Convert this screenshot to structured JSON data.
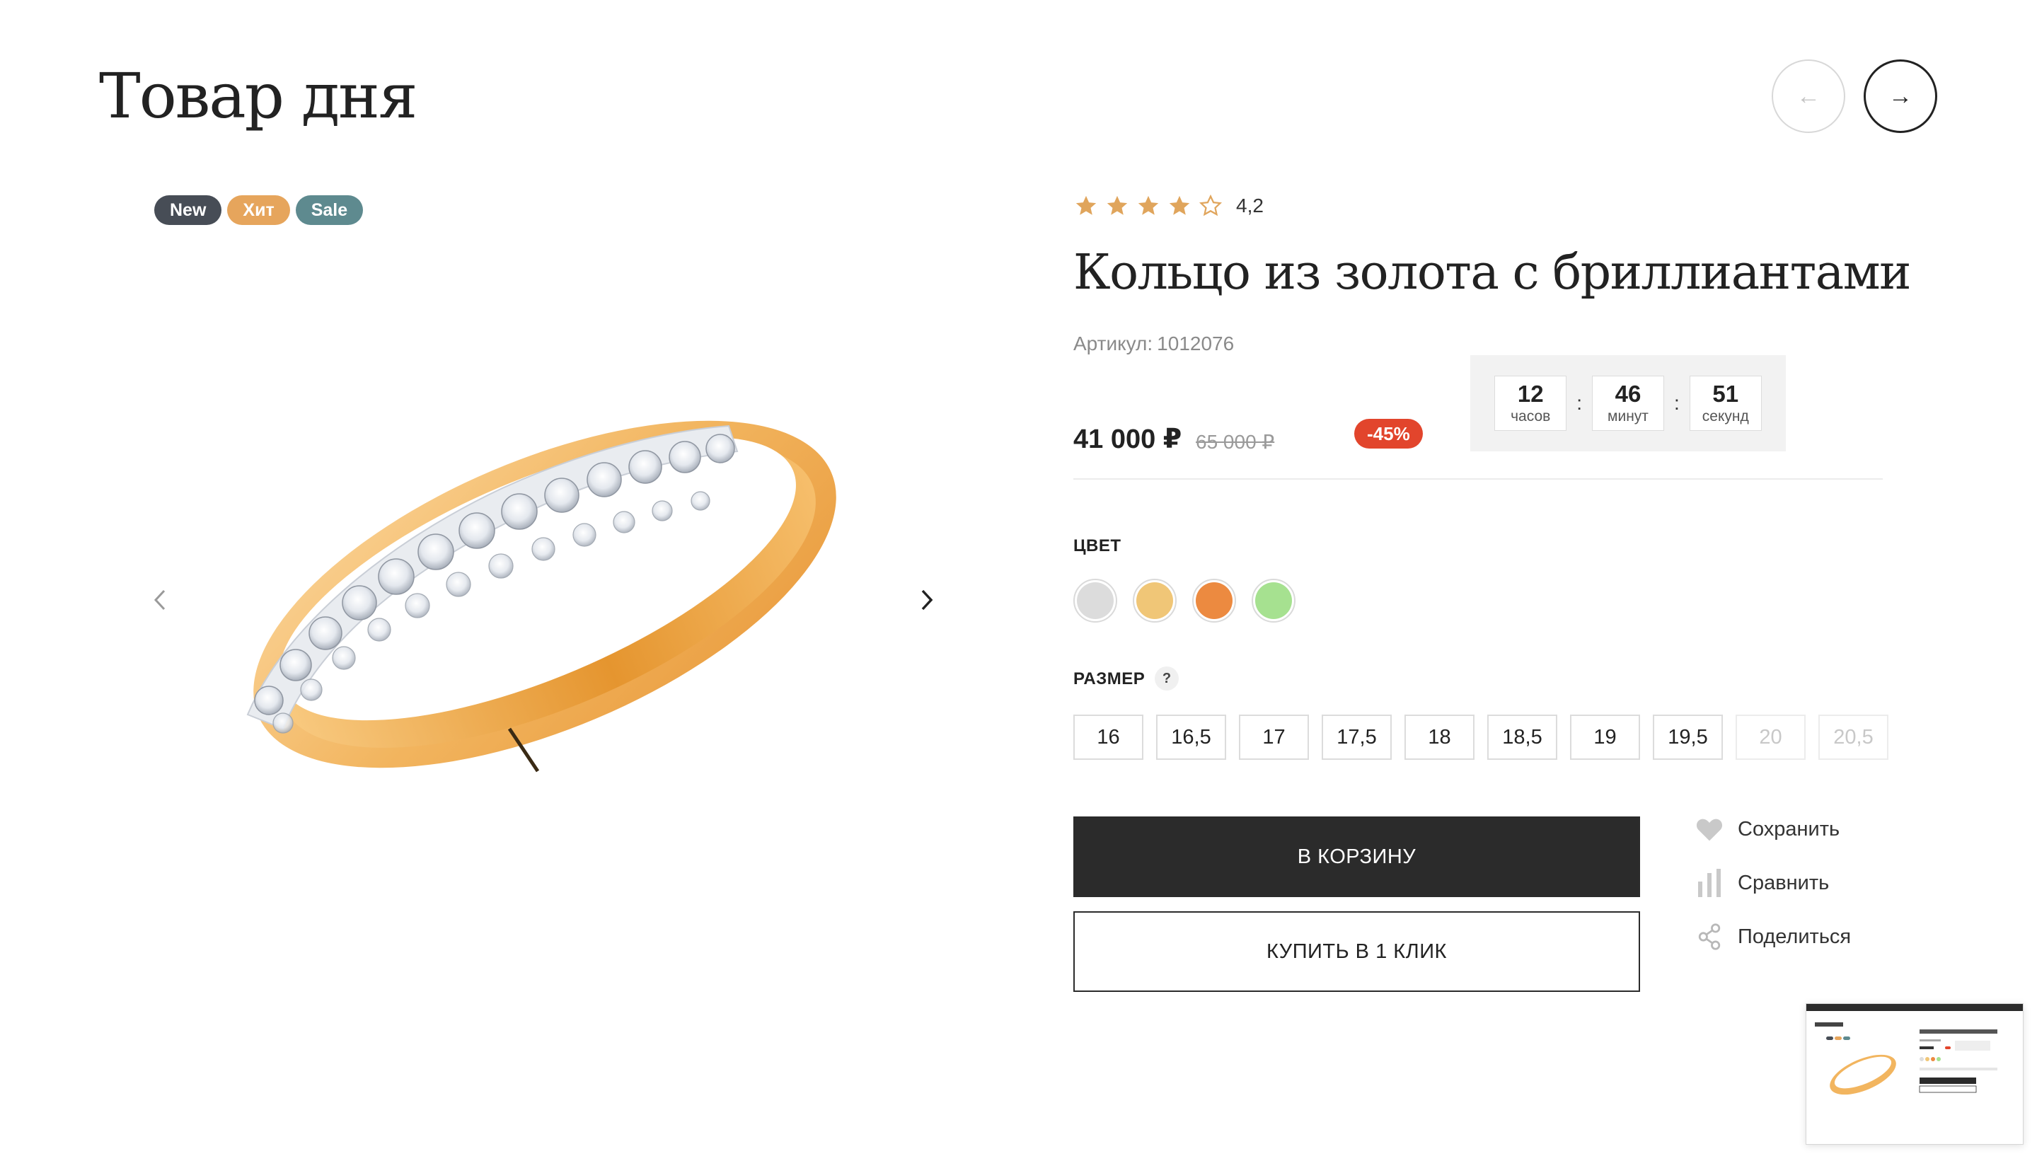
{
  "header": {
    "title": "Товар дня",
    "prev_arrow": "←",
    "next_arrow": "→"
  },
  "badges": [
    {
      "label": "New",
      "color": "#474d56"
    },
    {
      "label": "Хит",
      "color": "#e6a55c"
    },
    {
      "label": "Sale",
      "color": "#5e8a8f"
    }
  ],
  "gallery": {
    "prev_icon": "chevron-left-icon",
    "next_icon": "chevron-right-icon"
  },
  "product": {
    "rating": {
      "value": "4,2",
      "stars_filled": 4,
      "stars_total": 5,
      "star_color": "#e0a55c"
    },
    "title": "Кольцо из золота с бриллиантами",
    "sku_label": "Артикул:",
    "sku": "1012076",
    "price": "41 000 ₽",
    "old_price": "65 000 ₽",
    "discount": "-45%",
    "timer": {
      "hours": "12",
      "hours_label": "часов",
      "minutes": "46",
      "minutes_label": "минут",
      "seconds": "51",
      "seconds_label": "секунд",
      "separator": ":"
    },
    "color_label": "ЦВЕТ",
    "colors": [
      {
        "name": "silver",
        "hex": "#dcdcdc"
      },
      {
        "name": "gold",
        "hex": "#f0c677"
      },
      {
        "name": "orange",
        "hex": "#ec8a40"
      },
      {
        "name": "green",
        "hex": "#a6e190"
      }
    ],
    "size_label": "РАЗМЕР",
    "size_help": "?",
    "sizes": [
      {
        "label": "16",
        "available": true
      },
      {
        "label": "16,5",
        "available": true
      },
      {
        "label": "17",
        "available": true
      },
      {
        "label": "17,5",
        "available": true
      },
      {
        "label": "18",
        "available": true
      },
      {
        "label": "18,5",
        "available": true
      },
      {
        "label": "19",
        "available": true
      },
      {
        "label": "19,5",
        "available": true
      },
      {
        "label": "20",
        "available": false
      },
      {
        "label": "20,5",
        "available": false
      }
    ],
    "add_to_cart": "В КОРЗИНУ",
    "buy_one_click": "КУПИТЬ В 1 КЛИК"
  },
  "actions": [
    {
      "label": "Сохранить",
      "icon": "heart-icon"
    },
    {
      "label": "Сравнить",
      "icon": "compare-bars-icon"
    },
    {
      "label": "Поделиться",
      "icon": "share-icon"
    }
  ]
}
